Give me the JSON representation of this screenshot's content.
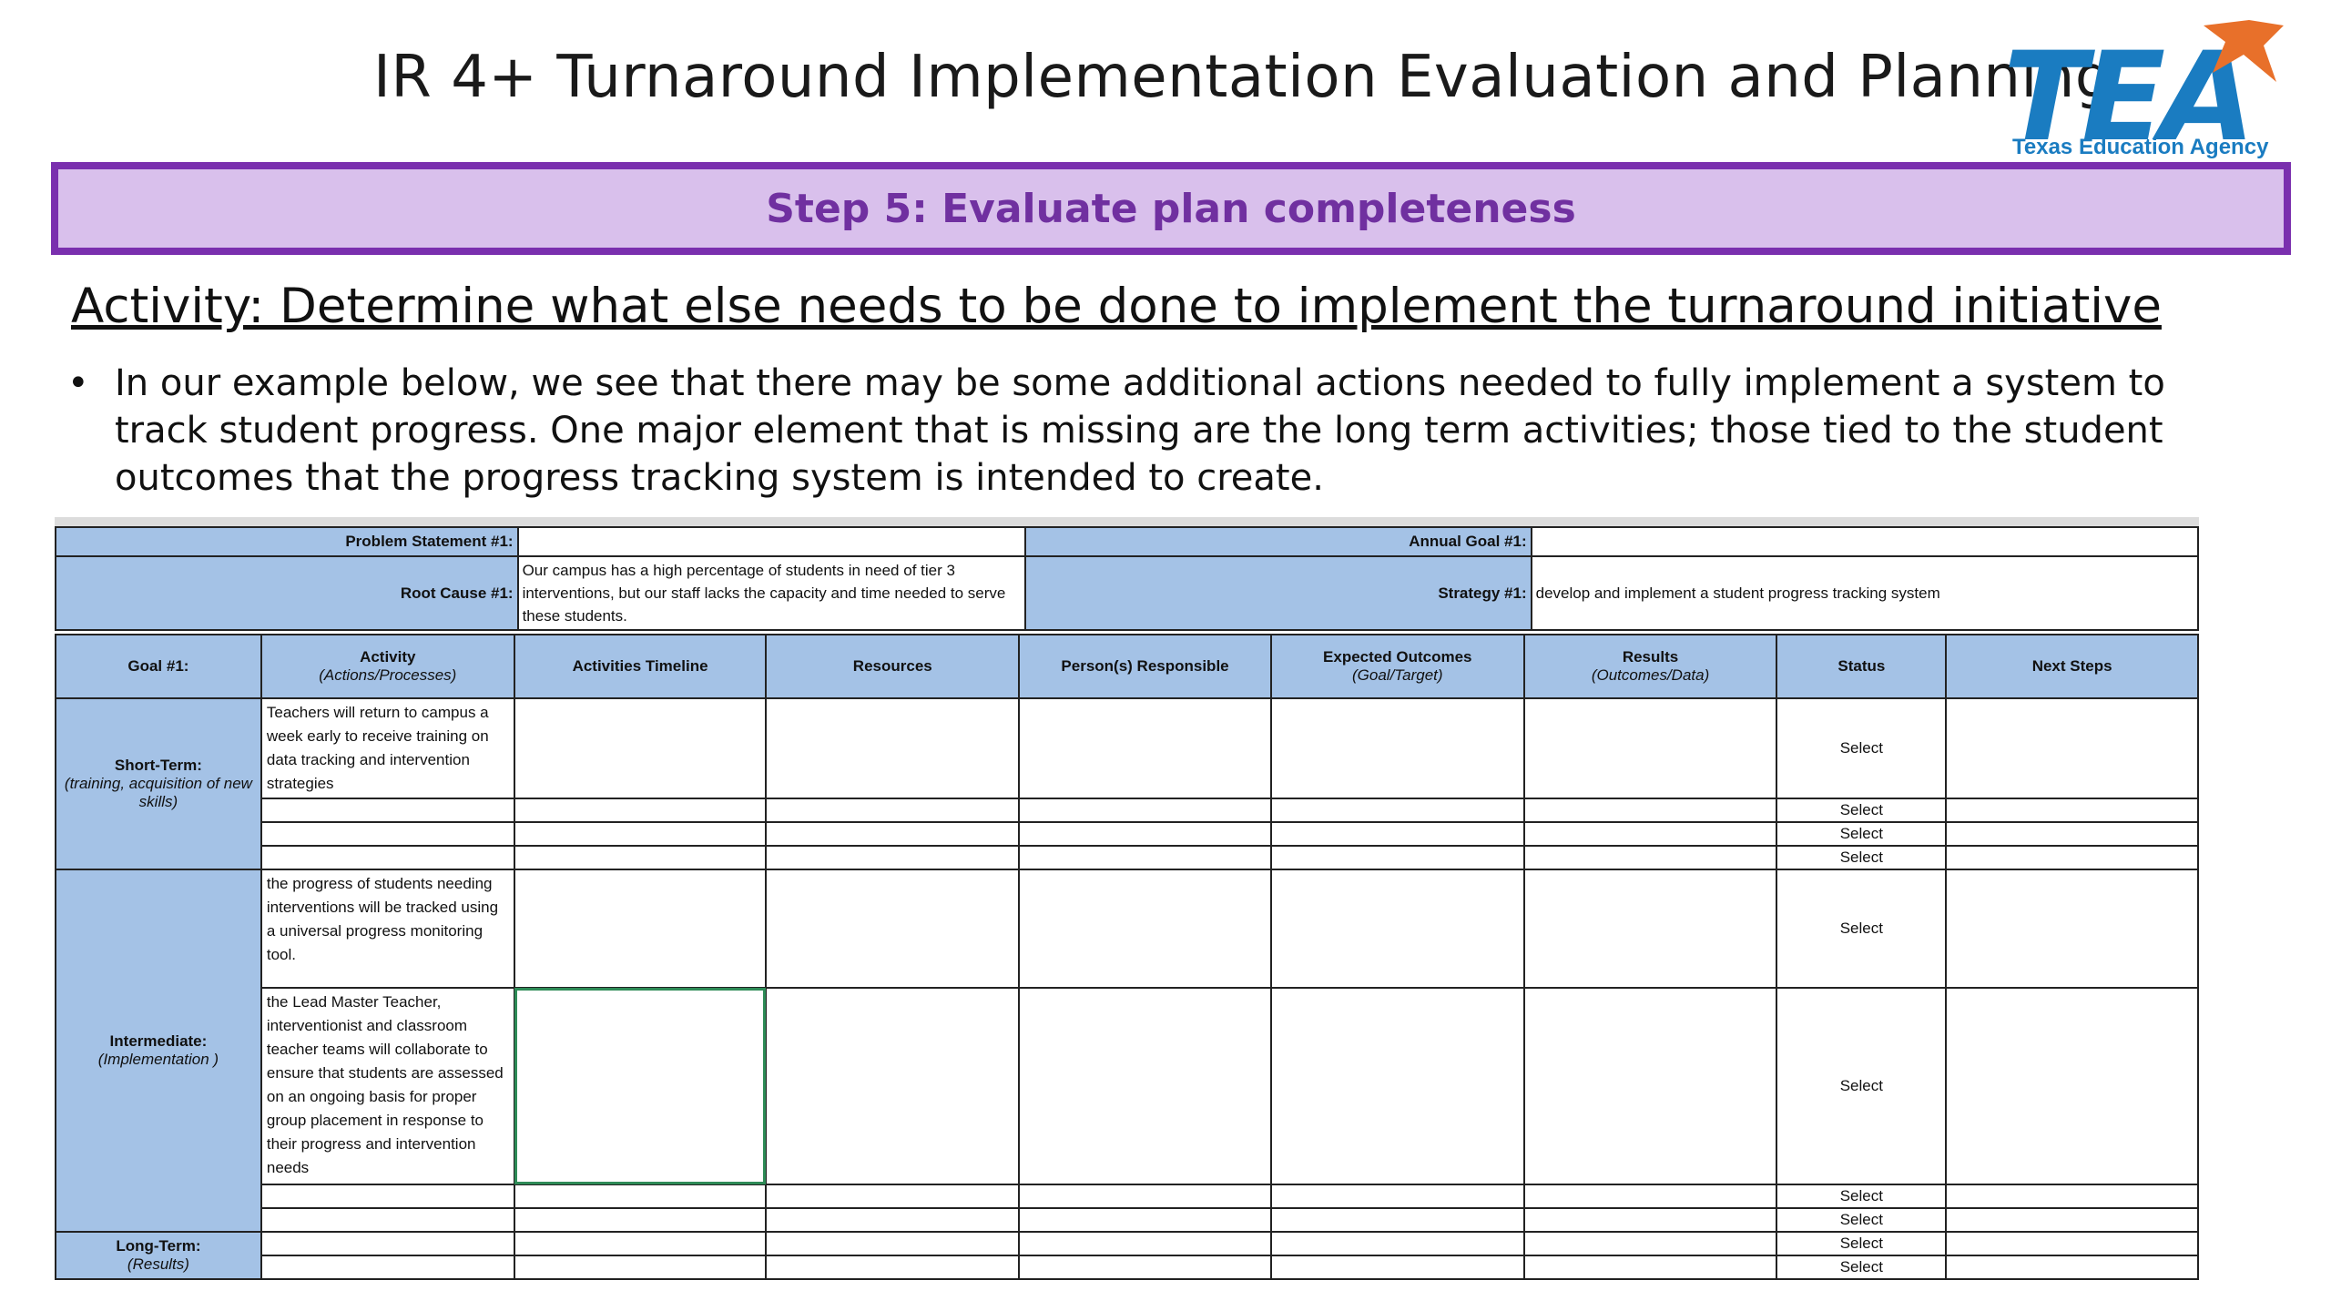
{
  "slide": {
    "title": "IR 4+ Turnaround Implementation Evaluation and  Planning",
    "logo_text": "TEA",
    "logo_subtitle": "Texas Education Agency",
    "step_banner": "Step 5: Evaluate plan completeness",
    "activity": "Activity: Determine what else needs to be done to implement the turnaround initiative",
    "bullet": "In our example below, we see that there may be some additional actions needed to fully implement a system to track student progress. One major element that is missing are the long term activities; those tied to the student outcomes that the progress tracking system is intended to create.",
    "bullet_symbol": "•"
  },
  "sheet": {
    "problem_statement_label": "Problem Statement #1:",
    "problem_statement_value": "",
    "root_cause_label": "Root Cause #1:",
    "root_cause_value": "Our campus has a high percentage of students in need of tier 3 interventions, but our staff lacks the capacity and time needed to serve these students.",
    "annual_goal_label": "Annual Goal #1:",
    "annual_goal_value": "",
    "strategy_label": "Strategy #1:",
    "strategy_value": "develop and implement a student progress tracking system",
    "columns": {
      "goal": "Goal #1:",
      "activity": "Activity",
      "activity_sub": "(Actions/Processes)",
      "timeline": "Activities Timeline",
      "resources": "Resources",
      "responsible": "Person(s) Responsible",
      "expected": "Expected Outcomes",
      "expected_sub": "(Goal/Target)",
      "results": "Results",
      "results_sub": "(Outcomes/Data)",
      "status": "Status",
      "next_steps": "Next Steps"
    },
    "phases": {
      "short_term": "Short-Term:",
      "short_term_sub": "(training, acquisition of new skills)",
      "intermediate": "Intermediate:",
      "intermediate_sub": "(Implementation )",
      "long_term": "Long-Term:",
      "long_term_sub": "(Results)"
    },
    "activities": {
      "a1": "Teachers will return to campus a week early to receive training on data tracking and intervention strategies",
      "a2": "the progress of students needing interventions will be tracked using a universal progress monitoring tool.",
      "a3": "the Lead Master Teacher, interventionist and classroom teacher teams will collaborate to ensure that students are assessed on an ongoing basis for proper group placement in response to their progress and intervention needs"
    },
    "status_select": "Select"
  }
}
